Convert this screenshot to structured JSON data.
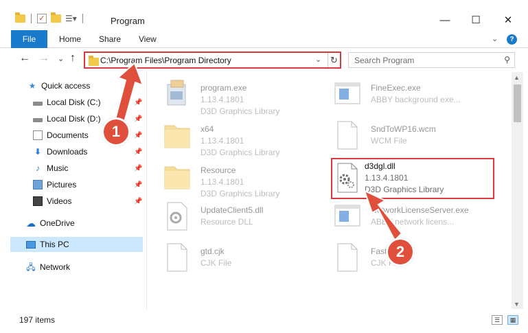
{
  "window": {
    "title": "Program",
    "minimize": "—",
    "maximize": "☐",
    "close": "✕"
  },
  "ribbon": {
    "tabs": [
      "File",
      "Home",
      "Share",
      "View"
    ],
    "expand": "⌄",
    "help": "?"
  },
  "nav": {
    "back": "←",
    "forward": "→",
    "recent": "⌄",
    "up": "↑",
    "address": "C:\\Program Files\\Program Directory",
    "address_dropdown": "⌄",
    "refresh": "↻",
    "search_placeholder": "Search Program",
    "search_icon": "⚲"
  },
  "sidebar": {
    "items": [
      {
        "label": "Quick access",
        "icon": "star-icon",
        "pinned": false
      },
      {
        "label": "Local Disk (C:)",
        "icon": "disk-icon",
        "pinned": true
      },
      {
        "label": "Local Disk (D:)",
        "icon": "disk-icon",
        "pinned": true
      },
      {
        "label": "Documents",
        "icon": "document-icon",
        "pinned": true
      },
      {
        "label": "Downloads",
        "icon": "download-icon",
        "pinned": true
      },
      {
        "label": "Music",
        "icon": "music-icon",
        "pinned": true
      },
      {
        "label": "Pictures",
        "icon": "pictures-icon",
        "pinned": true
      },
      {
        "label": "Videos",
        "icon": "videos-icon",
        "pinned": true
      },
      {
        "label": "OneDrive",
        "icon": "cloud-icon",
        "pinned": false
      },
      {
        "label": "This PC",
        "icon": "computer-icon",
        "pinned": false,
        "selected": true
      },
      {
        "label": "Network",
        "icon": "network-icon",
        "pinned": false
      }
    ]
  },
  "files": {
    "left": [
      {
        "name": "program.exe",
        "line2": "1.13.4.1801",
        "line3": "D3D Graphics Library",
        "icon": "exe-icon"
      },
      {
        "name": "x64",
        "line2": "1.13.4.1801",
        "line3": "D3D Graphics Library",
        "icon": "folder-icon"
      },
      {
        "name": "Resource",
        "line2": "1.13.4.1801",
        "line3": "D3D Graphics Library",
        "icon": "folder-icon"
      },
      {
        "name": "UpdateClient5.dll",
        "line2": "Resource DLL",
        "line3": "",
        "icon": "dll-icon"
      },
      {
        "name": "gtd.cjk",
        "line2": "CJK File",
        "line3": "",
        "icon": "file-icon"
      }
    ],
    "right": [
      {
        "name": "FineExec.exe",
        "line2": "ABBY background exe...",
        "line3": "",
        "icon": "window-icon"
      },
      {
        "name": "SndToWP16.wcm",
        "line2": "WCM File",
        "line3": "",
        "icon": "file-icon"
      },
      {
        "name": "NetworkLicenseServer.exe",
        "line2": "ABBY network licens...",
        "line3": "",
        "icon": "window-icon"
      },
      {
        "name": "FastR...",
        "line2": "CJK Fi...",
        "line3": "",
        "icon": "file-icon"
      }
    ],
    "highlighted": {
      "name": "d3dgl.dll",
      "line2": "1.13.4.1801",
      "line3": "D3D Graphics Library",
      "icon": "dll-gear-icon"
    }
  },
  "annotations": {
    "step1": "1",
    "step2": "2",
    "color": "#e04e3c"
  },
  "status": {
    "items_count": "197 items"
  }
}
